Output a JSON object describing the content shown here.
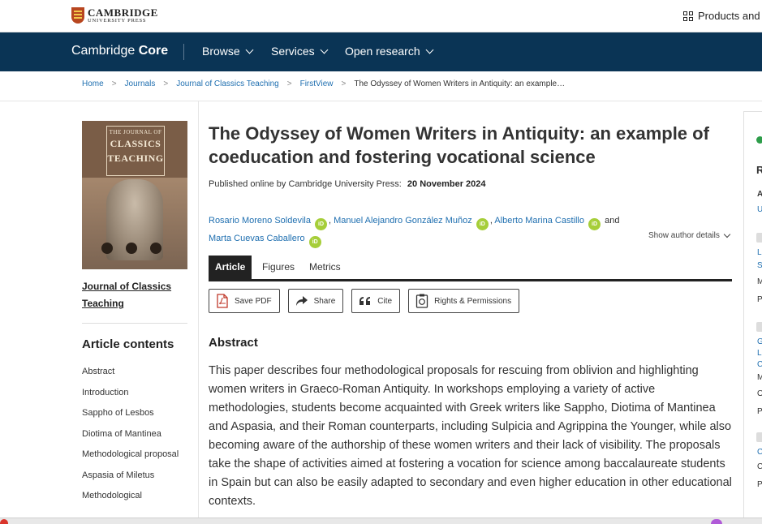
{
  "header": {
    "publisher_name": "CAMBRIDGE",
    "publisher_sub": "UNIVERSITY PRESS",
    "products_label": "Products and S"
  },
  "nav": {
    "brand_light": "Cambridge ",
    "brand_bold": "Core",
    "items": [
      {
        "label": "Browse"
      },
      {
        "label": "Services"
      },
      {
        "label": "Open research"
      }
    ]
  },
  "breadcrumb": {
    "items": [
      "Home",
      "Journals",
      "Journal of Classics Teaching",
      "FirstView"
    ],
    "separator": ">",
    "current": "The Odyssey of Women Writers in Antiquity: an example…"
  },
  "sidebar": {
    "cover": {
      "line1": "THE JOURNAL OF",
      "line2": "CLASSICS",
      "line3": "TEACHING"
    },
    "journal_link": "Journal of Classics Teaching",
    "contents_heading": "Article contents",
    "contents": [
      "Abstract",
      "Introduction",
      "Sappho of Lesbos",
      "Diotima of Mantinea",
      "Methodological proposal",
      "Aspasia of Miletus",
      "Methodological"
    ]
  },
  "article": {
    "title": "The Odyssey of Women Writers in Antiquity: an example of coeducation and fostering vocational science",
    "published_label": "Published online by Cambridge University Press:",
    "published_date": "20 November 2024",
    "authors": [
      "Rosario Moreno Soldevila",
      "Manuel Alejandro González Muñoz",
      "Alberto Marina Castillo",
      "Marta Cuevas Caballero"
    ],
    "orcid_label": "iD",
    "and_word": "and",
    "comma": ",",
    "show_details": "Show author details",
    "tabs": [
      {
        "label": "Article",
        "active": true
      },
      {
        "label": "Figures",
        "active": false
      },
      {
        "label": "Metrics",
        "active": false
      }
    ],
    "tools": [
      {
        "label": "Save PDF",
        "icon": "pdf-icon"
      },
      {
        "label": "Share",
        "icon": "share-icon"
      },
      {
        "label": "Cite",
        "icon": "quote-icon"
      },
      {
        "label": "Rights & Permissions",
        "icon": "rights-icon"
      }
    ],
    "abstract_heading": "Abstract",
    "abstract_text": "This paper describes four methodological proposals for rescuing from oblivion and highlighting women writers in Graeco-Roman Antiquity. In workshops employing a variety of active methodologies, students become acquainted with Greek writers like Sappho, Diotima of Mantinea and Aspasia, and their Roman counterparts, including Sulpicia and Agrippina the Younger, while also becoming aware of the authorship of these women writers and their lack of visibility. The proposals take the shape of activities aimed at fostering a vocation for science among baccalaureate students in Spain but can also be easily adapted to secondary and even higher education in other educational contexts."
  },
  "rail": {
    "fragments": [
      "R",
      "A",
      "U",
      "L",
      "S",
      "M",
      "P",
      "G",
      "L",
      "C",
      "M",
      "O",
      "P",
      "C",
      "C",
      "P"
    ]
  },
  "colors": {
    "nav_bg": "#0a3455",
    "link": "#1f6fb0",
    "orcid": "#a6ce39",
    "tab_active": "#222222"
  }
}
